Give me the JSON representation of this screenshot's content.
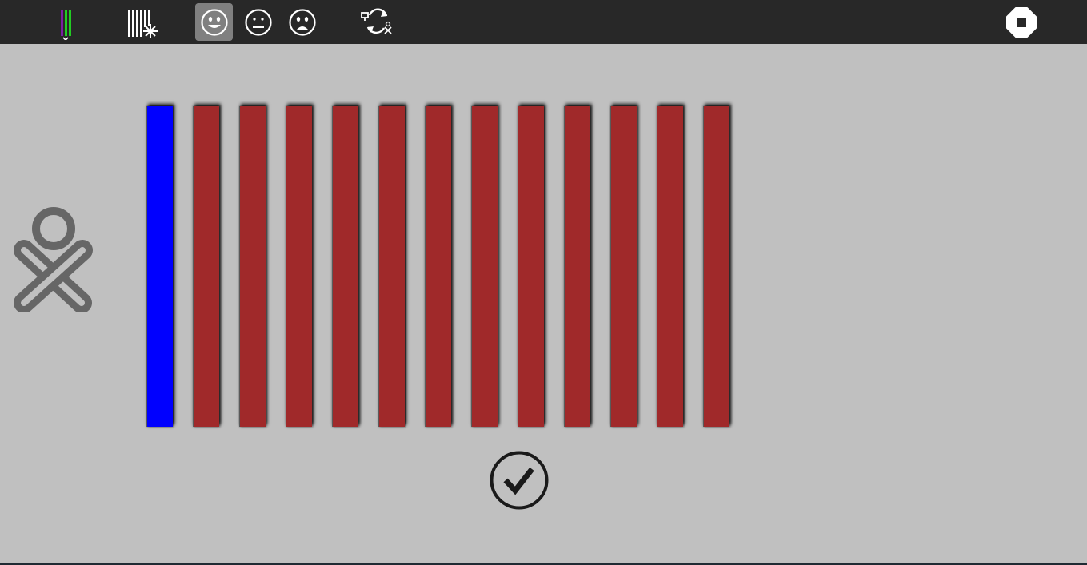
{
  "toolbar": {
    "items": [
      {
        "name": "activity-icon",
        "active": false
      },
      {
        "name": "barcode-spark-icon",
        "active": false
      },
      {
        "name": "happy-face-icon",
        "active": true
      },
      {
        "name": "neutral-face-icon",
        "active": false
      },
      {
        "name": "sad-face-icon",
        "active": false
      },
      {
        "name": "share-refresh-icon",
        "active": false
      }
    ],
    "stop_icon": "stop-icon"
  },
  "colors": {
    "toolbar_bg": "#282828",
    "canvas_bg": "#c0c0c0",
    "selected_bar": "#0000ff",
    "bar": "#a0292a",
    "xo_icon": "#666666",
    "check_icon": "#1a1a1a"
  },
  "bars": {
    "count": 13,
    "selected_index": 0
  },
  "main": {
    "xo_icon": "xo-person-icon",
    "check_icon": "check-circle-icon"
  }
}
